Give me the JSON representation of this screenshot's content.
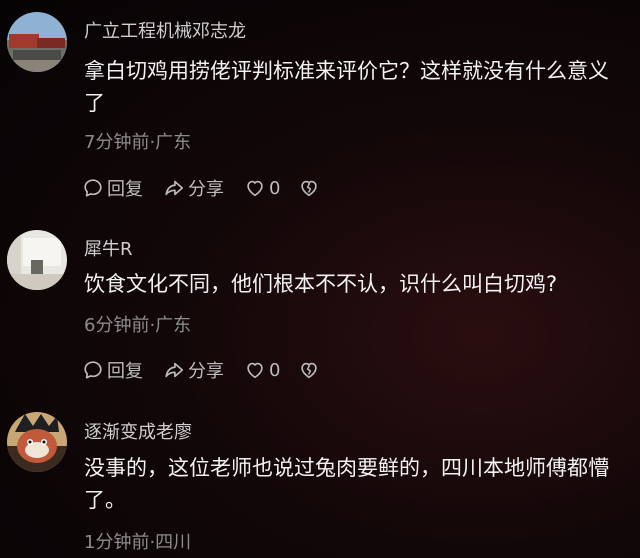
{
  "comments": [
    {
      "username": "广立工程机械邓志龙",
      "text": "拿白切鸡用捞佬评判标准来评价它？这样就没有什么意义了",
      "meta": "7分钟前·广东",
      "reply_label": "回复",
      "share_label": "分享",
      "like_count": "0"
    },
    {
      "username": "犀牛R",
      "text": "饮食文化不同，他们根本不不认，识什么叫白切鸡?",
      "meta": "6分钟前·广东",
      "reply_label": "回复",
      "share_label": "分享",
      "like_count": "0"
    },
    {
      "username": "逐渐变成老廖",
      "text": "没事的，这位老师也说过兔肉要鲜的，四川本地师傅都懵了。",
      "meta": "1分钟前·四川"
    }
  ],
  "icons": {
    "reply": "comment-bubble-icon",
    "share": "share-arrow-icon",
    "like": "heart-outline-icon",
    "dislike": "broken-heart-icon"
  }
}
